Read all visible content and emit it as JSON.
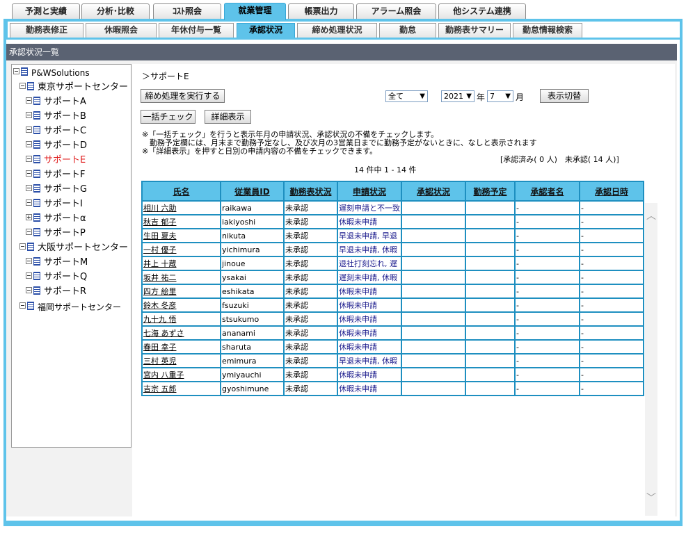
{
  "main_tabs": [
    {
      "label": "予測と実績"
    },
    {
      "label": "分析･比較"
    },
    {
      "label": "ｺｽﾄ照会"
    },
    {
      "label": "就業管理"
    },
    {
      "label": "帳票出力"
    },
    {
      "label": "アラーム照会"
    },
    {
      "label": "他システム連携"
    }
  ],
  "sub_tabs": [
    {
      "label": "勤務表修正"
    },
    {
      "label": "休暇照会"
    },
    {
      "label": "年休付与一覧"
    },
    {
      "label": "承認状況"
    },
    {
      "label": "締め処理状況"
    },
    {
      "label": "勤怠"
    },
    {
      "label": "勤務表サマリー"
    },
    {
      "label": "勤怠情報検索"
    }
  ],
  "page_title": "承認状況一覧",
  "tree": {
    "root": "P&WSolutions",
    "groups": [
      {
        "label": "東京サポートセンター"
      },
      {
        "label": "大阪サポートセンター"
      },
      {
        "label": "福岡サポートセンター"
      }
    ],
    "tokyo_children": [
      "サポートA",
      "サポートB",
      "サポートC",
      "サポートD",
      "サポートE",
      "サポートF",
      "サポートG",
      "サポートI",
      "サポートα",
      "サポートP"
    ],
    "osaka_children": [
      "サポートM",
      "サポートQ",
      "サポートR"
    ],
    "selected": "サポートE"
  },
  "breadcrumb": "＞サポートE",
  "toolbar": {
    "close_button": "締め処理を実行する",
    "check_all_button": "一括チェック",
    "detail_button": "詳細表示",
    "filter_value": "全て",
    "year_value": "2021",
    "year_suffix": "年",
    "month_value": "7",
    "month_suffix": "月",
    "toggle_button": "表示切替"
  },
  "notes": {
    "line1": "※「一括チェック」を行うと表示年月の申請状況、承認状況の不備をチェックします。",
    "line2": "　勤務予定欄には、月末まで勤務予定なし、及び次月の3営業日までに勤務予定がないときに、なしと表示されます",
    "line3": "※「詳細表示」を押すと日別の申請内容の不備をチェックできます。"
  },
  "summary": "[承認済み( 0 人)　未承認( 14 人)]",
  "count_text": "14 件中 1 - 14 件",
  "table": {
    "headers": [
      "氏名",
      "従業員ID",
      "勤務表状況",
      "申請状況",
      "承認状況",
      "勤務予定",
      "承認者名",
      "承認日時"
    ],
    "rows": [
      [
        "相川 六助",
        "raikawa",
        "未承認",
        "遅刻申請と不一致",
        "",
        "",
        "-",
        "-"
      ],
      [
        "秋吉 郁子",
        "iakiyoshi",
        "未承認",
        "休暇未申請",
        "",
        "",
        "-",
        "-"
      ],
      [
        "生田 夏夫",
        "nikuta",
        "未承認",
        "早退未申請, 早退",
        "",
        "",
        "-",
        "-"
      ],
      [
        "一村 優子",
        "yichimura",
        "未承認",
        "早退未申請, 休暇",
        "",
        "",
        "-",
        "-"
      ],
      [
        "井上 十蔵",
        "jinoue",
        "未承認",
        "退社打刻忘れ, 遅",
        "",
        "",
        "-",
        "-"
      ],
      [
        "坂井 祐二",
        "ysakai",
        "未承認",
        "遅刻未申請, 休暇",
        "",
        "",
        "-",
        "-"
      ],
      [
        "四方 絵里",
        "eshikata",
        "未承認",
        "休暇未申請",
        "",
        "",
        "-",
        "-"
      ],
      [
        "鈴木 冬彦",
        "fsuzuki",
        "未承認",
        "休暇未申請",
        "",
        "",
        "-",
        "-"
      ],
      [
        "九十九 悟",
        "stsukumo",
        "未承認",
        "休暇未申請",
        "",
        "",
        "-",
        "-"
      ],
      [
        "七海 あずさ",
        "ananami",
        "未承認",
        "休暇未申請",
        "",
        "",
        "-",
        "-"
      ],
      [
        "春田 幸子",
        "sharuta",
        "未承認",
        "休暇未申請",
        "",
        "",
        "-",
        "-"
      ],
      [
        "三村 英児",
        "emimura",
        "未承認",
        "早退未申請, 休暇",
        "",
        "",
        "-",
        "-"
      ],
      [
        "宮内 八重子",
        "ymiyauchi",
        "未承認",
        "休暇未申請",
        "",
        "",
        "-",
        "-"
      ],
      [
        "吉宗 五郎",
        "gyoshimune",
        "未承認",
        "休暇未申請",
        "",
        "",
        "-",
        "-"
      ]
    ]
  }
}
